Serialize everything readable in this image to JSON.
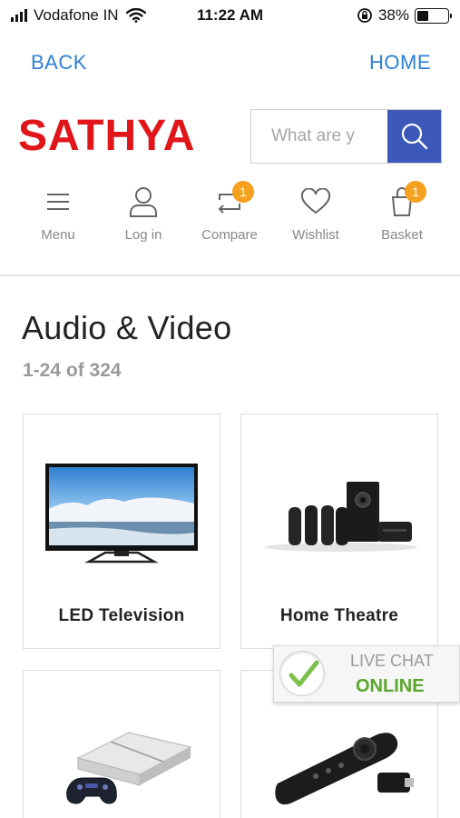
{
  "status_bar": {
    "carrier": "Vodafone IN",
    "time": "11:22 AM",
    "battery": "38%",
    "battery_level": 0.38
  },
  "nav": {
    "back_label": "BACK",
    "home_label": "HOME"
  },
  "header": {
    "logo_text": "SATHYA",
    "search_placeholder": "What are y",
    "colors": {
      "logo": "#e1161b",
      "search_button": "#3c58b8",
      "nav_link": "#2e7fd6",
      "badge": "#f5a01e"
    }
  },
  "icon_nav": [
    {
      "label": "Menu",
      "icon": "menu-icon"
    },
    {
      "label": "Log in",
      "icon": "user-icon"
    },
    {
      "label": "Compare",
      "icon": "compare-icon",
      "badge": "1"
    },
    {
      "label": "Wishlist",
      "icon": "heart-icon"
    },
    {
      "label": "Basket",
      "icon": "basket-icon",
      "badge": "1"
    }
  ],
  "category": {
    "title": "Audio & Video",
    "result_count": "1-24 of 324"
  },
  "products": [
    {
      "name": "LED Television",
      "image": "led-tv-image"
    },
    {
      "name": "Home Theatre",
      "image": "home-theatre-image"
    },
    {
      "name": "",
      "image": "game-console-image"
    },
    {
      "name": "",
      "image": "streaming-stick-image"
    }
  ],
  "live_chat": {
    "title": "LIVE CHAT",
    "status": "ONLINE"
  }
}
